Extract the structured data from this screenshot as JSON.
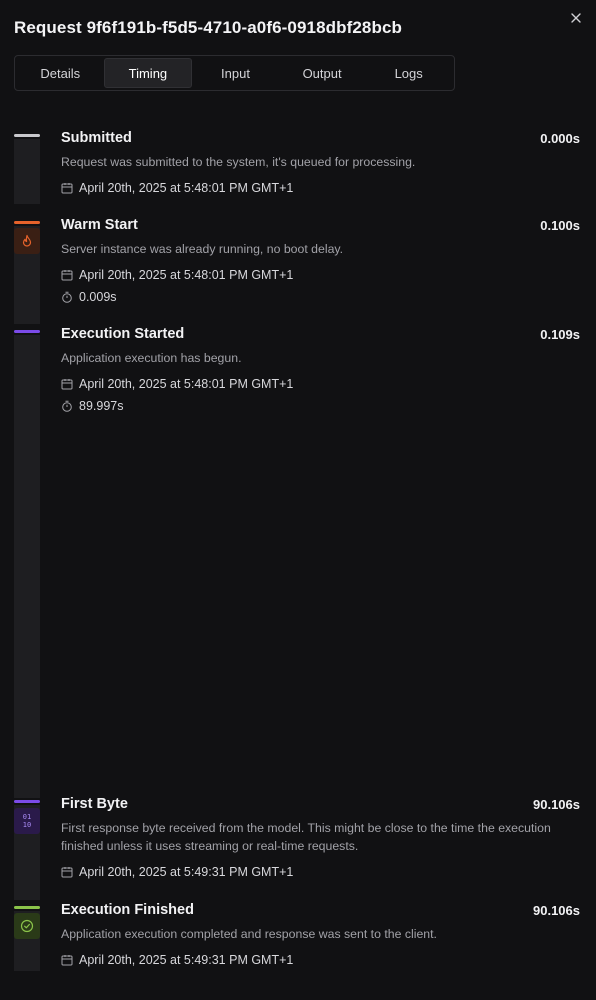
{
  "header": {
    "title": "Request 9f6f191b-f5d5-4710-a0f6-0918dbf28bcb",
    "close_icon": "close-icon"
  },
  "tabs": [
    {
      "label": "Details",
      "active": false
    },
    {
      "label": "Timing",
      "active": true
    },
    {
      "label": "Input",
      "active": false
    },
    {
      "label": "Output",
      "active": false
    },
    {
      "label": "Logs",
      "active": false
    }
  ],
  "colors": {
    "submitted": "#c8c8cc",
    "warm_start": "#e5622b",
    "execution_started": "#7b4be8",
    "first_byte": "#7b4be8",
    "execution_finished": "#8bc34a"
  },
  "events": [
    {
      "name": "Submitted",
      "time": "0.000s",
      "description": "Request was submitted to the system, it's queued for processing.",
      "date": "April 20th, 2025 at 5:48:01 PM GMT+1",
      "duration": null,
      "icon": null
    },
    {
      "name": "Warm Start",
      "time": "0.100s",
      "description": "Server instance was already running, no boot delay.",
      "date": "April 20th, 2025 at 5:48:01 PM GMT+1",
      "duration": "0.009s",
      "icon": "flame-icon"
    },
    {
      "name": "Execution Started",
      "time": "0.109s",
      "description": "Application execution has begun.",
      "date": "April 20th, 2025 at 5:48:01 PM GMT+1",
      "duration": "89.997s",
      "icon": null
    },
    {
      "name": "First Byte",
      "time": "90.106s",
      "description": "First response byte received from the model. This might be close to the time the execution finished unless it uses streaming or real-time requests.",
      "date": "April 20th, 2025 at 5:49:31 PM GMT+1",
      "duration": null,
      "icon": "binary-icon",
      "icon_text_top": "01",
      "icon_text_bottom": "10"
    },
    {
      "name": "Execution Finished",
      "time": "90.106s",
      "description": "Application execution completed and response was sent to the client.",
      "date": "April 20th, 2025 at 5:49:31 PM GMT+1",
      "duration": null,
      "icon": "check-circle-icon"
    }
  ]
}
